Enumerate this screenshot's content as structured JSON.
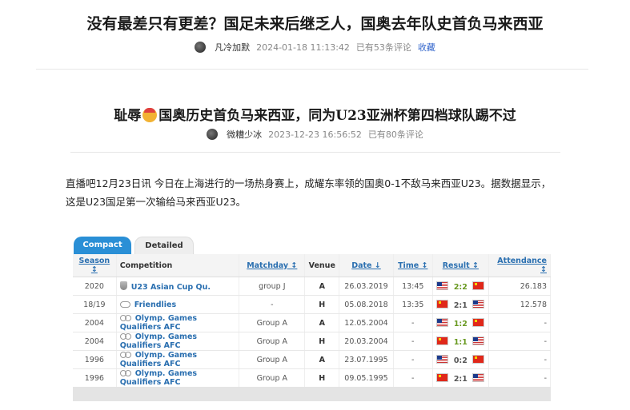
{
  "article": {
    "title": "没有最差只有更差？国足未来后继乏人，国奥去年队史首负马来西亚",
    "author": "凡冷加默",
    "datetime": "2024-01-18 11:13:42",
    "comments": "已有53条评论",
    "favorite": "收藏"
  },
  "embedded": {
    "title_prefix": "耻辱",
    "title_suffix": "国奥历史首负马来西亚，同为U23亚洲杯第四档球队踢不过",
    "author": "微糟少冰",
    "datetime": "2023-12-23 16:56:52",
    "comments": "已有80条评论"
  },
  "body_text": "直播吧12月23日讯 今日在上海进行的一场热身赛上，成耀东率领的国奥0-1不敌马来西亚U23。据数据显示，这是U23国足第一次输给马来西亚U23。",
  "tabs": {
    "compact": "Compact",
    "detailed": "Detailed"
  },
  "table": {
    "headers": {
      "season": "Season ↕",
      "competition": "Competition",
      "matchday": "Matchday ↕",
      "venue": "Venue",
      "date": "Date ↓",
      "time": "Time ↕",
      "result": "Result ↕",
      "attendance": "Attendance ↕"
    },
    "rows": [
      {
        "season": "2020",
        "competition": "U23 Asian Cup Qu.",
        "icon": "cup-icon",
        "matchday": "group J",
        "venue": "A",
        "date": "26.03.2019",
        "time": "13:45",
        "home_flag": "flag-malaysia",
        "score": "2:2",
        "away_flag": "flag-china",
        "attendance": "26.183"
      },
      {
        "season": "18/19",
        "competition": "Friendlies",
        "icon": "handshake-icon",
        "matchday": "-",
        "venue": "H",
        "date": "05.08.2018",
        "time": "13:35",
        "home_flag": "flag-china",
        "score": "2:1",
        "away_flag": "flag-malaysia",
        "attendance": "12.578"
      },
      {
        "season": "2004",
        "competition": "Olymp. Games Qualifiers AFC",
        "icon": "olympic-rings-icon",
        "matchday": "Group A",
        "venue": "A",
        "date": "12.05.2004",
        "time": "-",
        "home_flag": "flag-malaysia",
        "score": "1:2",
        "away_flag": "flag-china",
        "attendance": "-"
      },
      {
        "season": "2004",
        "competition": "Olymp. Games Qualifiers AFC",
        "icon": "olympic-rings-icon",
        "matchday": "Group A",
        "venue": "H",
        "date": "20.03.2004",
        "time": "-",
        "home_flag": "flag-china",
        "score": "1:1",
        "away_flag": "flag-malaysia",
        "attendance": "-"
      },
      {
        "season": "1996",
        "competition": "Olymp. Games Qualifiers AFC",
        "icon": "olympic-rings-icon",
        "matchday": "Group A",
        "venue": "A",
        "date": "23.07.1995",
        "time": "-",
        "home_flag": "flag-malaysia",
        "score": "0:2",
        "away_flag": "flag-china",
        "attendance": "-"
      },
      {
        "season": "1996",
        "competition": "Olymp. Games Qualifiers AFC",
        "icon": "olympic-rings-icon",
        "matchday": "Group A",
        "venue": "H",
        "date": "09.05.1995",
        "time": "-",
        "home_flag": "flag-china",
        "score": "2:1",
        "away_flag": "flag-malaysia",
        "attendance": "-"
      }
    ]
  },
  "colors": {
    "tab_active": "#2a8fd6",
    "link": "#2a6fb0",
    "draw_score": "#6a9a22"
  }
}
